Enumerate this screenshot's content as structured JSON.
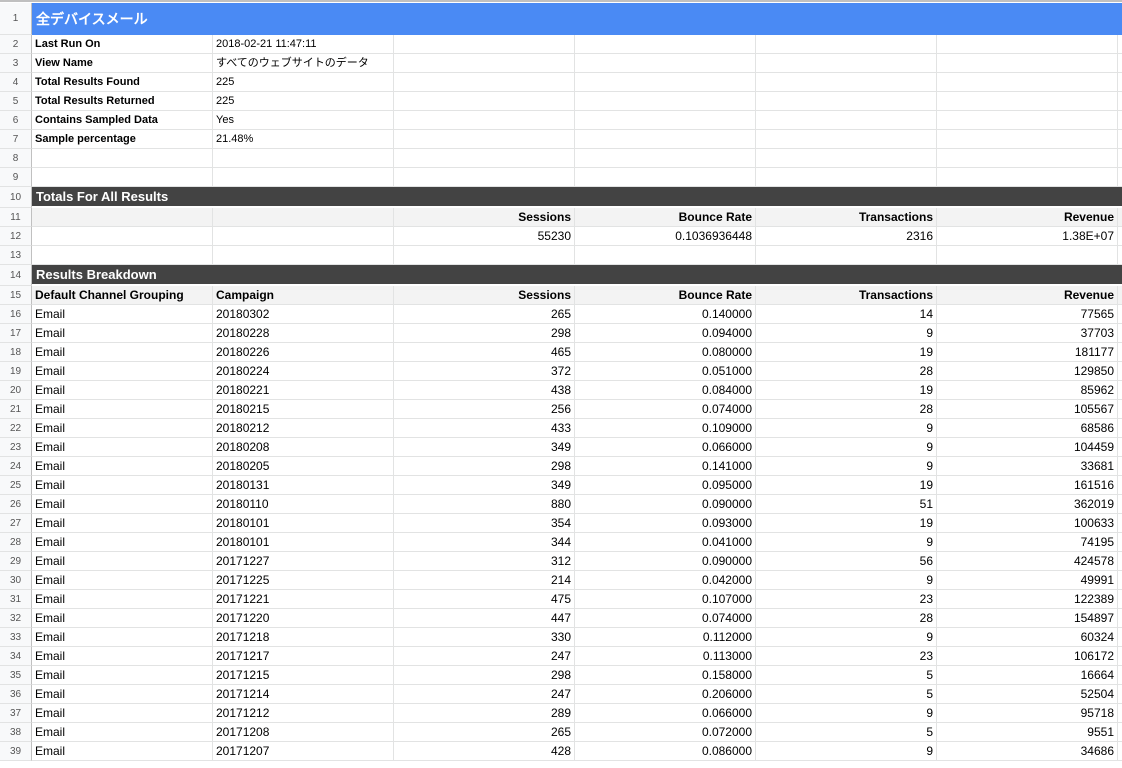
{
  "title": "全デバイスメール",
  "meta": [
    {
      "label": "Last Run On",
      "value": "2018-02-21 11:47:11"
    },
    {
      "label": "View Name",
      "value": "すべてのウェブサイトのデータ"
    },
    {
      "label": "Total Results Found",
      "value": "225"
    },
    {
      "label": "Total Results Returned",
      "value": "225"
    },
    {
      "label": "Contains Sampled Data",
      "value": "Yes"
    },
    {
      "label": "Sample percentage",
      "value": "21.48%"
    }
  ],
  "totals_title": "Totals For All Results",
  "totals_headers": [
    "",
    "",
    "Sessions",
    "Bounce Rate",
    "Transactions",
    "Revenue"
  ],
  "totals_values": [
    "",
    "",
    "55230",
    "0.1036936448",
    "2316",
    "1.38E+07"
  ],
  "breakdown_title": "Results Breakdown",
  "breakdown_headers": [
    "Default Channel Grouping",
    "Campaign",
    "Sessions",
    "Bounce Rate",
    "Transactions",
    "Revenue"
  ],
  "breakdown_rows": [
    [
      "Email",
      "20180302",
      "265",
      "0.140000",
      "14",
      "77565"
    ],
    [
      "Email",
      "20180228",
      "298",
      "0.094000",
      "9",
      "37703"
    ],
    [
      "Email",
      "20180226",
      "465",
      "0.080000",
      "19",
      "181177"
    ],
    [
      "Email",
      "20180224",
      "372",
      "0.051000",
      "28",
      "129850"
    ],
    [
      "Email",
      "20180221",
      "438",
      "0.084000",
      "19",
      "85962"
    ],
    [
      "Email",
      "20180215",
      "256",
      "0.074000",
      "28",
      "105567"
    ],
    [
      "Email",
      "20180212",
      "433",
      "0.109000",
      "9",
      "68586"
    ],
    [
      "Email",
      "20180208",
      "349",
      "0.066000",
      "9",
      "104459"
    ],
    [
      "Email",
      "20180205",
      "298",
      "0.141000",
      "9",
      "33681"
    ],
    [
      "Email",
      "20180131",
      "349",
      "0.095000",
      "19",
      "161516"
    ],
    [
      "Email",
      "20180110",
      "880",
      "0.090000",
      "51",
      "362019"
    ],
    [
      "Email",
      "20180101",
      "354",
      "0.093000",
      "19",
      "100633"
    ],
    [
      "Email",
      "20180101",
      "344",
      "0.041000",
      "9",
      "74195"
    ],
    [
      "Email",
      "20171227",
      "312",
      "0.090000",
      "56",
      "424578"
    ],
    [
      "Email",
      "20171225",
      "214",
      "0.042000",
      "9",
      "49991"
    ],
    [
      "Email",
      "20171221",
      "475",
      "0.107000",
      "23",
      "122389"
    ],
    [
      "Email",
      "20171220",
      "447",
      "0.074000",
      "28",
      "154897"
    ],
    [
      "Email",
      "20171218",
      "330",
      "0.112000",
      "9",
      "60324"
    ],
    [
      "Email",
      "20171217",
      "247",
      "0.113000",
      "23",
      "106172"
    ],
    [
      "Email",
      "20171215",
      "298",
      "0.158000",
      "5",
      "16664"
    ],
    [
      "Email",
      "20171214",
      "247",
      "0.206000",
      "5",
      "52504"
    ],
    [
      "Email",
      "20171212",
      "289",
      "0.066000",
      "9",
      "95718"
    ],
    [
      "Email",
      "20171208",
      "265",
      "0.072000",
      "5",
      "9551"
    ],
    [
      "Email",
      "20171207",
      "428",
      "0.086000",
      "9",
      "34686"
    ]
  ],
  "row_numbers": [
    "1",
    "2",
    "3",
    "4",
    "5",
    "6",
    "7",
    "8",
    "9",
    "10",
    "11",
    "12",
    "13",
    "14",
    "15",
    "16",
    "17",
    "18",
    "19",
    "20",
    "21",
    "22",
    "23",
    "24",
    "25",
    "26",
    "27",
    "28",
    "29",
    "30",
    "31",
    "32",
    "33",
    "34",
    "35",
    "36",
    "37",
    "38",
    "39"
  ],
  "colors": {
    "title_band": "#4a8af4",
    "section_band": "#434343",
    "header_bg": "#f3f3f3"
  }
}
